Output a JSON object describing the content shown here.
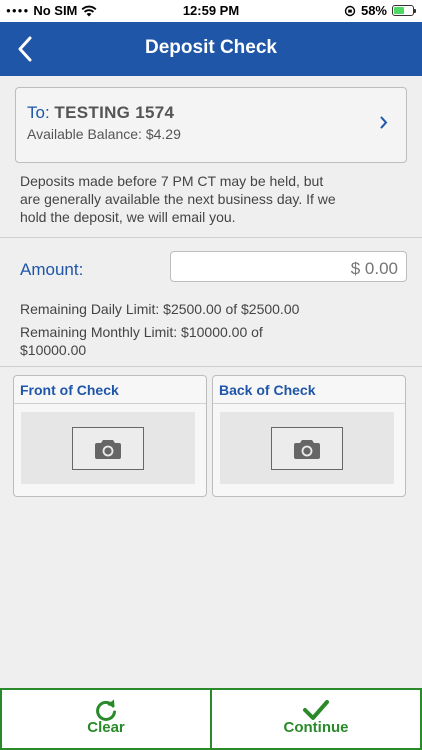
{
  "status_bar": {
    "carrier": "No SIM",
    "time": "12:59 PM",
    "battery": "58%",
    "battery_level": 0.58,
    "battery_color": "#4cd964"
  },
  "nav": {
    "title": "Deposit Check",
    "back_icon": "chevron-left-icon",
    "bar_color": "#1f56a8"
  },
  "account": {
    "to_label": "To:",
    "account_name": "TESTING 1574",
    "balance": "Available Balance: $4.29",
    "chevron_icon": "chevron-right-icon"
  },
  "notice": "Deposits made before 7 PM CT may be held, but are generally available the next business day. If we hold the deposit, we will email you.",
  "amount": {
    "label": "Amount:",
    "placeholder": "$ 0.00",
    "value": ""
  },
  "limits": {
    "daily": "Remaining Daily Limit: $2500.00 of $2500.00",
    "monthly": "Remaining Monthly Limit: $10000.00 of $10000.00"
  },
  "checks": {
    "front_title": "Front of Check",
    "back_title": "Back of Check",
    "camera_icon": "camera-icon"
  },
  "actions": {
    "clear_label": "Clear",
    "continue_label": "Continue",
    "clear_icon": "refresh-icon",
    "continue_icon": "checkmark-icon",
    "accent": "#2a8a2a"
  }
}
